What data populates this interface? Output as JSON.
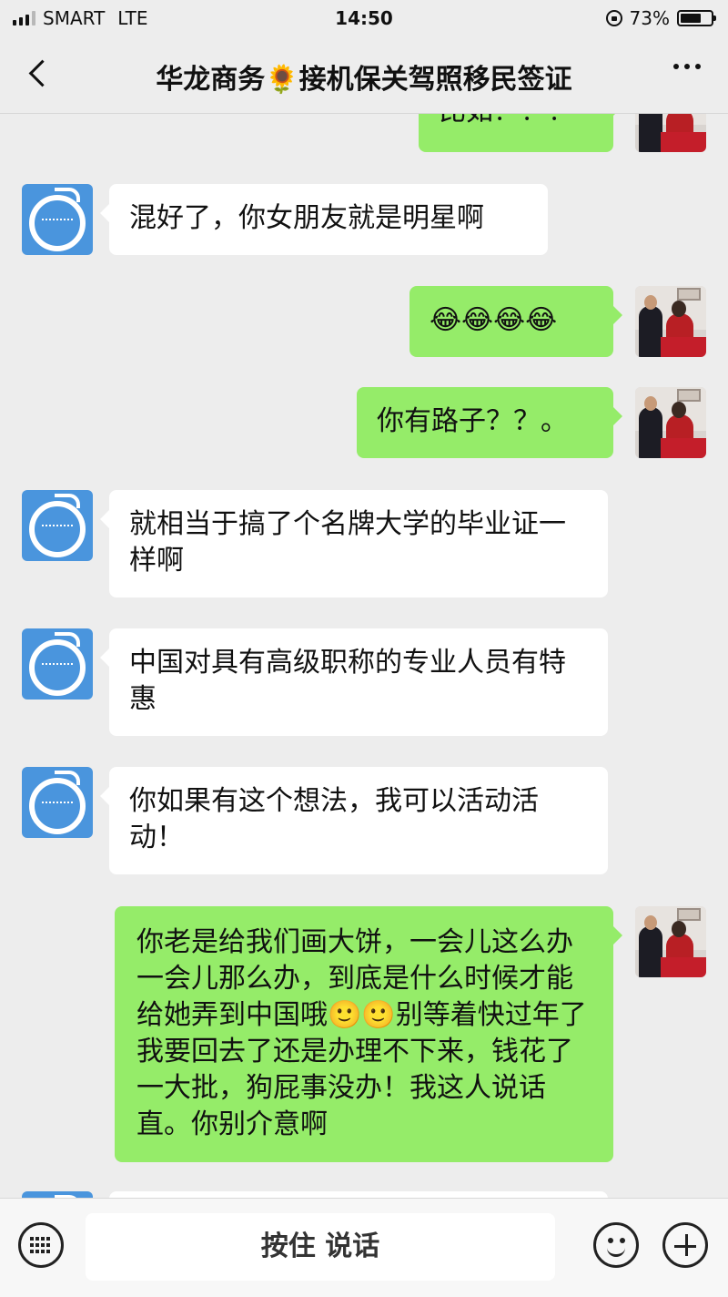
{
  "status_bar": {
    "carrier": "SMART",
    "network": "LTE",
    "time": "14:50",
    "battery": "73%",
    "battery_level": 0.73
  },
  "header": {
    "title": "华龙商务🌻接机保关驾照移民签证"
  },
  "messages": [
    {
      "side": "out",
      "text": "比如？？？"
    },
    {
      "side": "in",
      "text": "混好了，你女朋友就是明星啊"
    },
    {
      "side": "out",
      "text": "😂😂😂😂"
    },
    {
      "side": "out",
      "text": "你有路子？？。"
    },
    {
      "side": "in",
      "text": "就相当于搞了个名牌大学的毕业证一样啊"
    },
    {
      "side": "in",
      "text": "中国对具有高级职称的专业人员有特惠"
    },
    {
      "side": "in",
      "text": "你如果有这个想法，我可以活动活动！"
    },
    {
      "side": "out",
      "text": "你老是给我们画大饼，一会儿这么办一会儿那么办，到底是什么时候才能给她弄到中国哦🙂🙂别等着快过年了我要回去了还是办理不下来，钱花了一大批，狗屁事没办！我这人说话直。你别介意啊"
    }
  ],
  "input_bar": {
    "hold_to_talk": "按住 说话"
  },
  "colors": {
    "outgoing_bubble": "#95ec69",
    "incoming_bubble": "#ffffff",
    "background": "#ededed",
    "contact_avatar": "#4a95dd"
  }
}
